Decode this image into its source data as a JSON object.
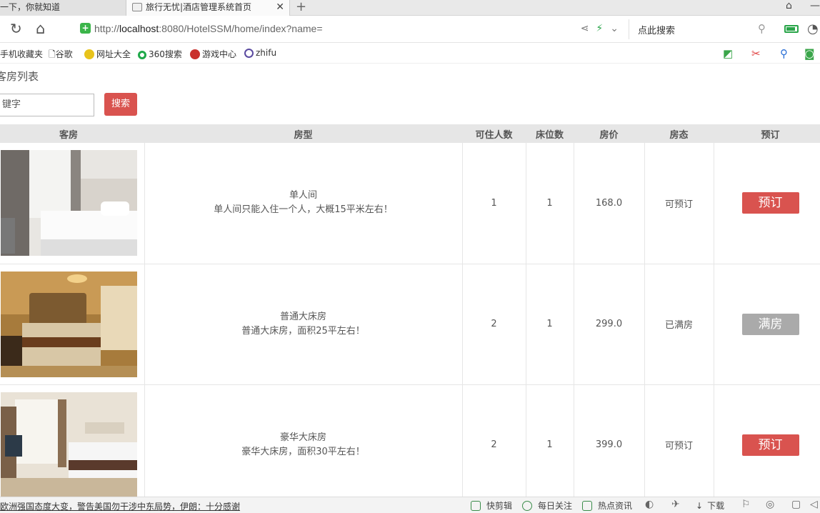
{
  "browser": {
    "tabs": [
      {
        "label": "一下，你就知道"
      },
      {
        "label": "旅行无忧|酒店管理系统首页"
      }
    ],
    "url_prefix": "http://",
    "url_host": "localhost",
    "url_rest": ":8080/HotelSSM/home/index?name=",
    "search_placeholder": "点此搜索",
    "bookmarks": [
      {
        "label": "手机收藏夹"
      },
      {
        "label": "谷歌"
      },
      {
        "label": "网址大全"
      },
      {
        "label": "360搜索"
      },
      {
        "label": "游戏中心"
      },
      {
        "label": "zhifu"
      }
    ]
  },
  "page": {
    "title": "客房列表",
    "keyword_placeholder": "键字",
    "search_button": "搜索",
    "columns": [
      "客房",
      "房型",
      "可住人数",
      "床位数",
      "房价",
      "房态",
      "预订"
    ],
    "rooms": [
      {
        "type_name": "单人间",
        "type_desc": "单人间只能入住一个人，大概15平米左右！",
        "capacity": "1",
        "beds": "1",
        "price": "168.0",
        "status": "可预订",
        "action": "预订",
        "available": true
      },
      {
        "type_name": "普通大床房",
        "type_desc": "普通大床房，面积25平左右！",
        "capacity": "2",
        "beds": "1",
        "price": "299.0",
        "status": "已满房",
        "action": "满房",
        "available": false
      },
      {
        "type_name": "豪华大床房",
        "type_desc": "豪华大床房，面积30平左右！",
        "capacity": "2",
        "beds": "1",
        "price": "399.0",
        "status": "可预订",
        "action": "预订",
        "available": true
      }
    ]
  },
  "statusbar": {
    "news": "欧洲强国态度大变，警告美国勿干涉中东局势，伊朗：十分感谢",
    "items": [
      {
        "label": "快剪辑"
      },
      {
        "label": "每日关注"
      },
      {
        "label": "热点资讯"
      },
      {
        "label": "下载"
      }
    ]
  },
  "colors": {
    "accent_red": "#d9534f",
    "disabled_gray": "#aaaaaa",
    "secure_green": "#3bb54a"
  }
}
